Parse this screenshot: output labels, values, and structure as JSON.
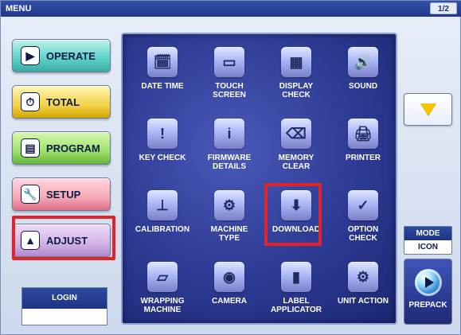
{
  "window": {
    "title": "MENU",
    "page_indicator": "1/2"
  },
  "left_menu": {
    "items": [
      {
        "label": "OPERATE",
        "icon": "play-circle-icon"
      },
      {
        "label": "TOTAL",
        "icon": "clock-icon"
      },
      {
        "label": "PROGRAM",
        "icon": "book-icon"
      },
      {
        "label": "SETUP",
        "icon": "wrench-icon"
      },
      {
        "label": "ADJUST",
        "icon": "adjust-icon"
      }
    ],
    "selected": "ADJUST"
  },
  "login": {
    "label": "LOGIN"
  },
  "grid": {
    "tiles": [
      {
        "label": "DATE TIME",
        "icon": "calendar-clock-icon"
      },
      {
        "label": "TOUCH\nSCREEN",
        "icon": "touch-screen-icon"
      },
      {
        "label": "DISPLAY\nCHECK",
        "icon": "display-check-icon"
      },
      {
        "label": "SOUND",
        "icon": "speaker-icon"
      },
      {
        "label": "KEY CHECK",
        "icon": "key-check-icon"
      },
      {
        "label": "FIRMWARE\nDETAILS",
        "icon": "info-icon"
      },
      {
        "label": "MEMORY\nCLEAR",
        "icon": "memory-clear-icon"
      },
      {
        "label": "PRINTER",
        "icon": "printer-icon"
      },
      {
        "label": "CALIBRATION",
        "icon": "calibration-icon"
      },
      {
        "label": "MACHINE\nTYPE",
        "icon": "gears-icon"
      },
      {
        "label": "DOWNLOAD",
        "icon": "download-folder-icon"
      },
      {
        "label": "OPTION\nCHECK",
        "icon": "option-check-icon"
      },
      {
        "label": "WRAPPING\nMACHINE",
        "icon": "wrapping-machine-icon"
      },
      {
        "label": "CAMERA",
        "icon": "camera-icon"
      },
      {
        "label": "LABEL\nAPPLICATOR",
        "icon": "label-applicator-icon"
      },
      {
        "label": "UNIT ACTION",
        "icon": "unit-action-icon"
      }
    ],
    "highlighted_tile": "DOWNLOAD"
  },
  "right_panel": {
    "scroll_down_icon": "triangle-down-icon",
    "mode": {
      "label": "MODE",
      "value": "ICON"
    },
    "prepack": {
      "label": "PREPACK",
      "icon": "play-circle-icon"
    }
  },
  "colors": {
    "highlight": "#e3232a",
    "panel_blue": "#2c3a93"
  }
}
